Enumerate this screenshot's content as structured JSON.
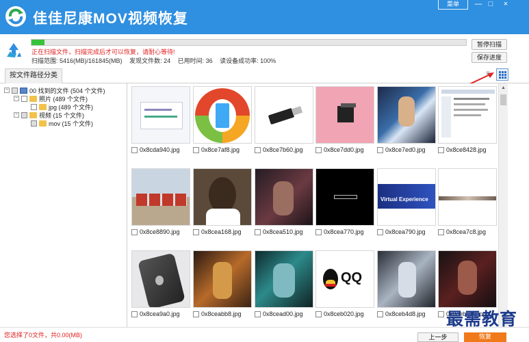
{
  "app": {
    "title": "佳佳尼康MOV视频恢复",
    "menu_label": "菜单",
    "minimize": "—",
    "maximize": "□",
    "close": "×"
  },
  "scan": {
    "progress": 0.03,
    "status": "正在扫描文件，扫描完成后才可以恢复，请耐心等待!",
    "range_label": "扫描范围: 5416(MB)/161845(MB)",
    "found_label": "发现文件数: 24",
    "time_label": "已用时间: 36",
    "success_label": "读设备成功率: 100%",
    "pause_button": "暂停扫描",
    "save_button": "保存进度"
  },
  "tabs": {
    "by_path": "按文件路径分类"
  },
  "tree": {
    "root": "00 找到的文件 (504 个文件)",
    "photos": "照片    (489 个文件)",
    "jpg": "jpg    (489 个文件)",
    "videos": "视频    (15 个文件)",
    "mov": "mov    (15 个文件)"
  },
  "thumbnails": [
    {
      "name": "0x8cda940.jpg",
      "kind": "screenshot"
    },
    {
      "name": "0x8ce7af8.jpg",
      "kind": "phone-icon"
    },
    {
      "name": "0x8ce7b60.jpg",
      "kind": "usb"
    },
    {
      "name": "0x8ce7dd0.jpg",
      "kind": "pink-box"
    },
    {
      "name": "0x8ce7ed0.jpg",
      "kind": "game-art"
    },
    {
      "name": "0x8ce8428.jpg",
      "kind": "webpage"
    },
    {
      "name": "0x8ce8890.jpg",
      "kind": "trucks"
    },
    {
      "name": "0x8cea168.jpg",
      "kind": "portrait"
    },
    {
      "name": "0x8cea510.jpg",
      "kind": "dark-art"
    },
    {
      "name": "0x8cea770.jpg",
      "kind": "black-logo"
    },
    {
      "name": "0x8cea790.jpg",
      "kind": "virtual-experience"
    },
    {
      "name": "0x8cea7c8.jpg",
      "kind": "strip"
    },
    {
      "name": "0x8cea9a0.jpg",
      "kind": "iphone"
    },
    {
      "name": "0x8ceabb8.jpg",
      "kind": "warrior"
    },
    {
      "name": "0x8cead00.jpg",
      "kind": "fantasy"
    },
    {
      "name": "0x8ceb020.jpg",
      "kind": "qq-logo"
    },
    {
      "name": "0x8ceb4d8.jpg",
      "kind": "silver-art"
    },
    {
      "name": "0x8ceb510.jpg",
      "kind": "dark-portrait"
    }
  ],
  "thumb_texts": {
    "virtual": "Virtual Experience",
    "qq": "QQ"
  },
  "footer": {
    "hint": "您选择了0文件，共0.00(MB)",
    "prev": "上一步",
    "next": "恢复"
  },
  "watermark": "最需教育",
  "colors": {
    "titlebar": "#2f8fe0",
    "progress": "#38c33a",
    "status_red": "#e02020",
    "accent_orange": "#f07a1a"
  }
}
